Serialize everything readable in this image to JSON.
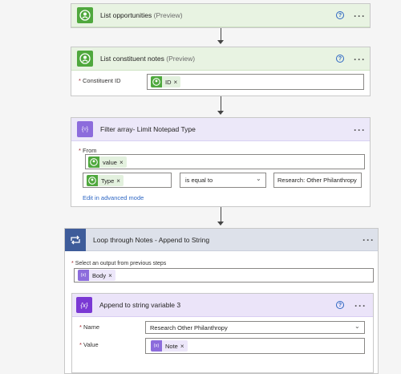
{
  "steps": {
    "list_opportunities": {
      "title": "List opportunities",
      "badge": "(Preview)",
      "help": "?",
      "more": "···"
    },
    "list_constituent_notes": {
      "title": "List constituent notes",
      "badge": "(Preview)",
      "help": "?",
      "more": "···",
      "fields": {
        "constituent_id": {
          "required_mark": "*",
          "label": "Constituent ID",
          "token": "ID",
          "remove": "×"
        }
      }
    },
    "filter_array": {
      "title": "Filter array- Limit Notepad Type",
      "more": "···",
      "icon_glyph": "{▿}",
      "from": {
        "required_mark": "*",
        "label": "From",
        "token": "value",
        "remove": "×"
      },
      "condition": {
        "left_token": "Type",
        "remove": "×",
        "operator": "is equal to",
        "right_value": "Research: Other Philanthropy"
      },
      "advanced_link": "Edit in advanced mode"
    },
    "loop": {
      "title": "Loop through Notes - Append to String",
      "more": "···",
      "select_output": {
        "required_mark": "*",
        "label": "Select an output from previous steps",
        "token": "Body",
        "remove": "×",
        "token_icon": "{x}"
      }
    },
    "append": {
      "title": "Append to string variable 3",
      "help": "?",
      "more": "···",
      "icon_glyph": "{x}",
      "name": {
        "required_mark": "*",
        "label": "Name",
        "value": "Research Other Philanthropy"
      },
      "value": {
        "required_mark": "*",
        "label": "Value",
        "token": "Note",
        "remove": "×",
        "token_icon": "{x}"
      }
    }
  },
  "colors": {
    "connector_green": "#4fa83d",
    "filter_purple": "#8c6cdc",
    "loop_blue": "#3e5c9a",
    "variable_purple": "#7a38d4",
    "link_blue": "#2d66c3"
  }
}
